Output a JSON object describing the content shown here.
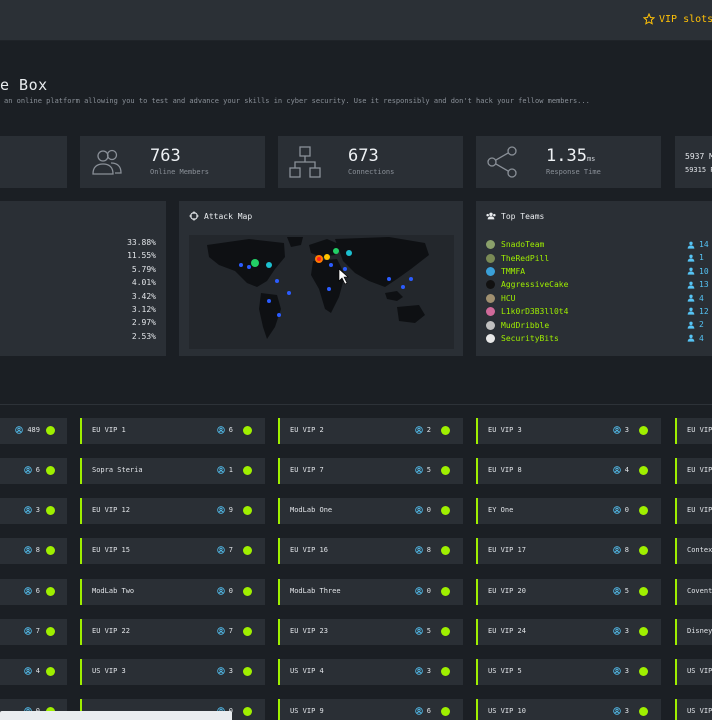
{
  "topbar": {
    "vip_link": "VIP slots l"
  },
  "header": {
    "title": "e Box",
    "description": "an online platform allowing you to test and advance your skills in cyber security. Use it responsibly and don't hack your fellow members..."
  },
  "stats": [
    {
      "value": "763",
      "label": "Online Members",
      "icon": "users-icon"
    },
    {
      "value": "673",
      "label": "Connections",
      "icon": "network-icon"
    },
    {
      "value": "1.35",
      "unit": "ms",
      "label": "Response Time",
      "icon": "share-icon"
    }
  ],
  "partial_stat": {
    "line1": "5937 M",
    "line2": "59315 P"
  },
  "percentages": [
    "33.88%",
    "11.55%",
    "5.79%",
    "4.01%",
    "3.42%",
    "3.12%",
    "2.97%",
    "2.53%"
  ],
  "attack_map": {
    "title": "Attack Map"
  },
  "top_teams": {
    "title": "Top Teams",
    "teams": [
      {
        "name": "SnadoTeam",
        "count": "14",
        "avatar_color": "#8aa06a"
      },
      {
        "name": "TheRedPill",
        "count": "1",
        "avatar_color": "#7a8a55"
      },
      {
        "name": "TMMFA",
        "count": "10",
        "avatar_color": "#3aa0d8"
      },
      {
        "name": "AggressiveCake",
        "count": "13",
        "avatar_color": "#111111"
      },
      {
        "name": "HCU",
        "count": "4",
        "avatar_color": "#a09070"
      },
      {
        "name": "L1k0rD3B3ll0t4",
        "count": "12",
        "avatar_color": "#d06a9a"
      },
      {
        "name": "MudDribble",
        "count": "2",
        "avatar_color": "#c0c0c0"
      },
      {
        "name": "SecurityBits",
        "count": "4",
        "avatar_color": "#e8e8e8"
      }
    ]
  },
  "servers": [
    [
      {
        "name": "",
        "count": "489"
      },
      {
        "name": "EU VIP 1",
        "count": "6"
      },
      {
        "name": "EU VIP 2",
        "count": "2"
      },
      {
        "name": "EU VIP 3",
        "count": "3"
      },
      {
        "name": "EU VIP",
        "count": ""
      }
    ],
    [
      {
        "name": "",
        "count": "6"
      },
      {
        "name": "Sopra Steria",
        "count": "1"
      },
      {
        "name": "EU VIP 7",
        "count": "5"
      },
      {
        "name": "EU VIP 8",
        "count": "4"
      },
      {
        "name": "EU VIP",
        "count": ""
      }
    ],
    [
      {
        "name": "",
        "count": "3"
      },
      {
        "name": "EU VIP 12",
        "count": "9"
      },
      {
        "name": "ModLab One",
        "count": "0"
      },
      {
        "name": "EY One",
        "count": "0"
      },
      {
        "name": "EU VIP",
        "count": ""
      }
    ],
    [
      {
        "name": "",
        "count": "8"
      },
      {
        "name": "EU VIP 15",
        "count": "7"
      },
      {
        "name": "EU VIP 16",
        "count": "8"
      },
      {
        "name": "EU VIP 17",
        "count": "8"
      },
      {
        "name": "Contex",
        "count": ""
      }
    ],
    [
      {
        "name": "",
        "count": "6"
      },
      {
        "name": "ModLab Two",
        "count": "0"
      },
      {
        "name": "ModLab Three",
        "count": "0"
      },
      {
        "name": "EU VIP 20",
        "count": "5"
      },
      {
        "name": "Covent",
        "count": ""
      }
    ],
    [
      {
        "name": "",
        "count": "7"
      },
      {
        "name": "EU VIP 22",
        "count": "7"
      },
      {
        "name": "EU VIP 23",
        "count": "5"
      },
      {
        "name": "EU VIP 24",
        "count": "3"
      },
      {
        "name": "Disney",
        "count": ""
      }
    ],
    [
      {
        "name": "",
        "count": "4"
      },
      {
        "name": "US VIP 3",
        "count": "3"
      },
      {
        "name": "US VIP 4",
        "count": "3"
      },
      {
        "name": "US VIP 5",
        "count": "3"
      },
      {
        "name": "US VIP",
        "count": ""
      }
    ],
    [
      {
        "name": "",
        "count": "0"
      },
      {
        "name": "",
        "count": "0"
      },
      {
        "name": "US VIP 9",
        "count": "6"
      },
      {
        "name": "US VIP 10",
        "count": "3"
      },
      {
        "name": "US VIP",
        "count": ""
      }
    ]
  ],
  "colors": {
    "accent": "#9fef00",
    "user_blue": "#55c3f4",
    "vip_yellow": "#ffc107"
  }
}
